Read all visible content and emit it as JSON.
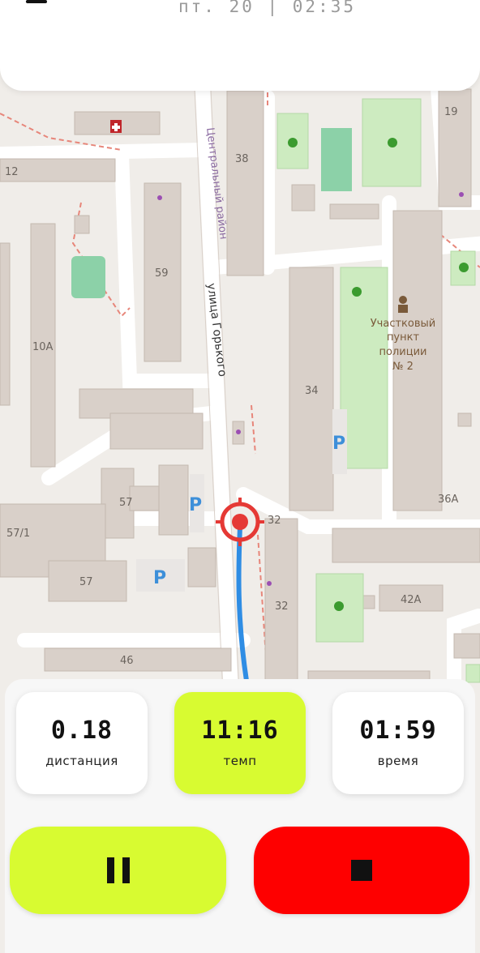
{
  "header": {
    "datetime": "пт. 20 | 02:35"
  },
  "map": {
    "streets": {
      "main_street": "улица Горького",
      "district": "Центральный район"
    },
    "poi": {
      "police_label": [
        "Участковый",
        "пункт",
        "полиции",
        "№ 2"
      ]
    },
    "buildings": [
      "12",
      "38",
      "19",
      "59",
      "10А",
      "34",
      "57",
      "57/1",
      "32",
      "32",
      "36А",
      "57",
      "42А",
      "46"
    ],
    "parking_label": "P"
  },
  "stats": [
    {
      "value": "0.18",
      "label": "дистанция"
    },
    {
      "value": "11:16",
      "label": "темп"
    },
    {
      "value": "01:59",
      "label": "время"
    }
  ],
  "colors": {
    "accent": "#d8fb31",
    "stop": "#fe0000",
    "route": "#2f8de4",
    "marker": "#e53935"
  },
  "controls": {
    "pause_icon": "pause-icon",
    "stop_icon": "stop-icon"
  }
}
